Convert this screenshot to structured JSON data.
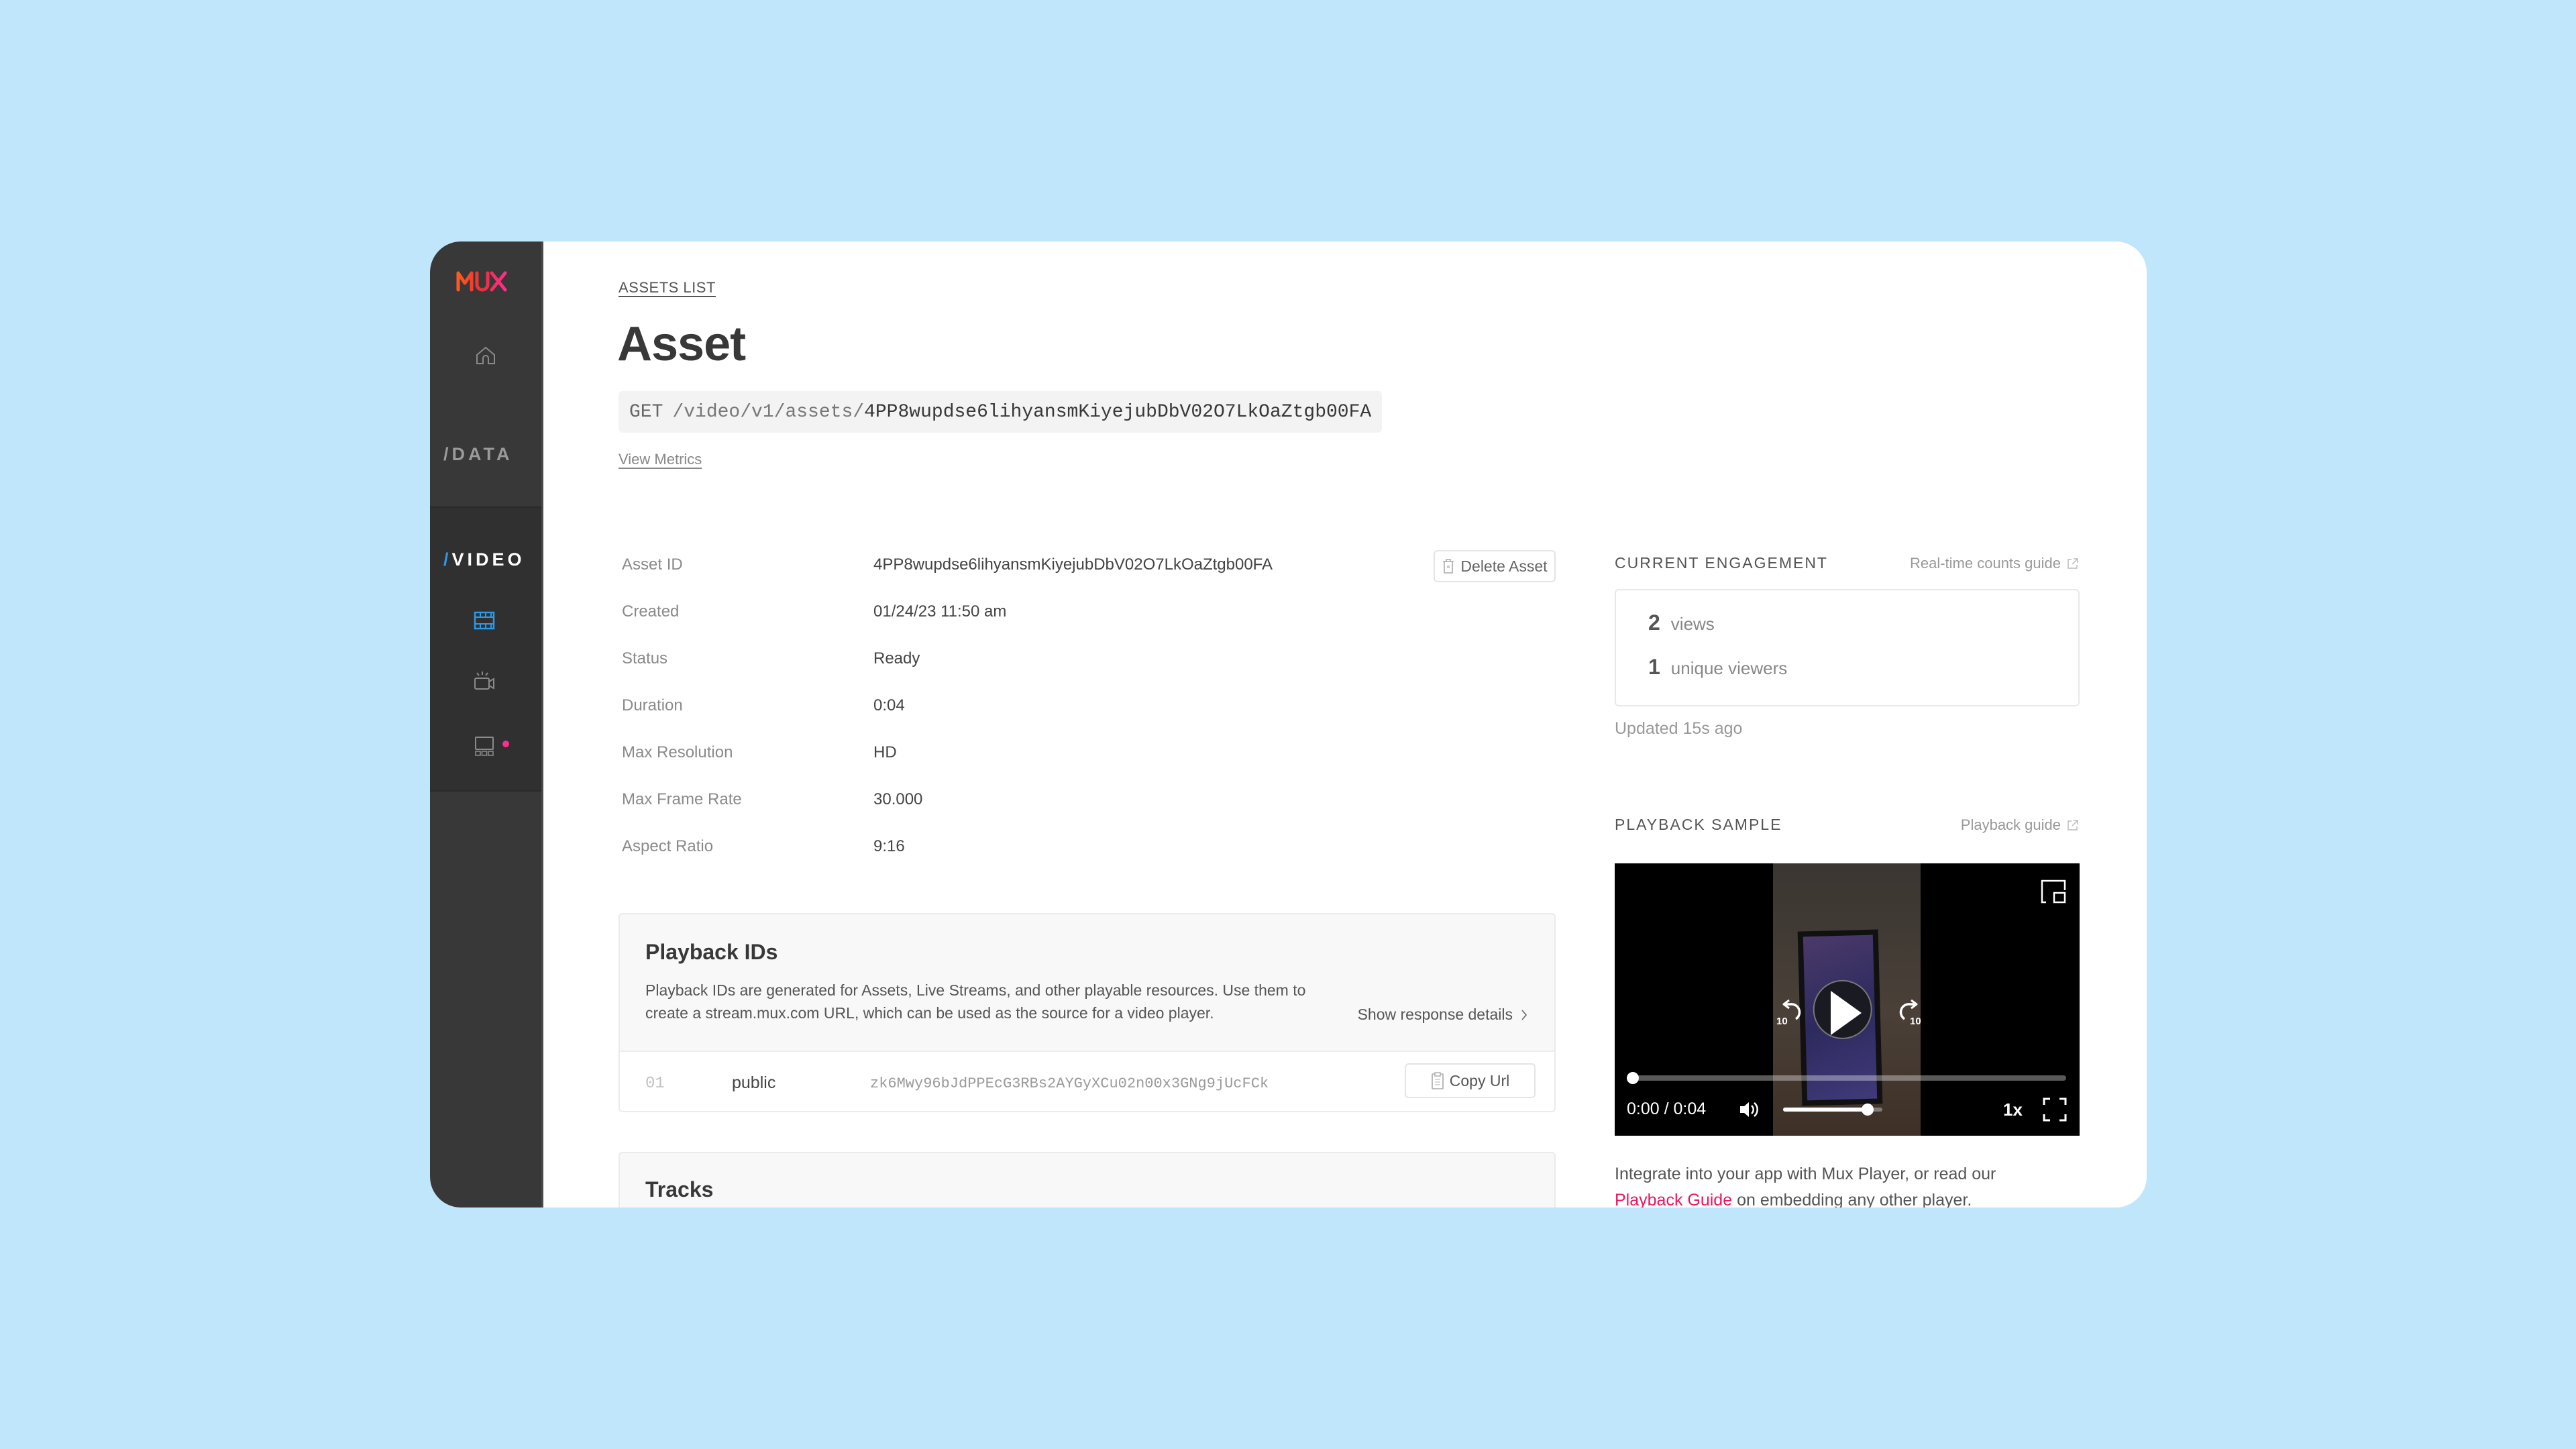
{
  "sidebar": {
    "logo": "MUX",
    "sections": [
      {
        "label": "/DATA"
      },
      {
        "label_slash": "/",
        "label": "VIDEO",
        "items": [
          {
            "name": "assets",
            "icon": "film-icon",
            "active": true
          },
          {
            "name": "live-streams",
            "icon": "live-camera-icon",
            "active": false
          },
          {
            "name": "players",
            "icon": "player-icon",
            "active": false,
            "badge": "new-dot"
          }
        ]
      }
    ],
    "accent": "#2b9ae9",
    "badge_color": "#ff2e8c"
  },
  "header": {
    "breadcrumb": "ASSETS LIST",
    "title": "Asset",
    "endpoint": {
      "method": "GET",
      "path": "/video/v1/assets/",
      "id": "4PP8wupdse6lihyansmKiyejubDbV02O7LkOaZtgb00FA"
    },
    "view_metrics": "View Metrics"
  },
  "details": {
    "rows": [
      {
        "label": "Asset ID",
        "value": "4PP8wupdse6lihyansmKiyejubDbV02O7LkOaZtgb00FA"
      },
      {
        "label": "Created",
        "value": "01/24/23 11:50 am"
      },
      {
        "label": "Status",
        "value": "Ready"
      },
      {
        "label": "Duration",
        "value": "0:04"
      },
      {
        "label": "Max Resolution",
        "value": "HD"
      },
      {
        "label": "Max Frame Rate",
        "value": "30.000"
      },
      {
        "label": "Aspect Ratio",
        "value": "9:16"
      }
    ],
    "delete_button": "Delete Asset"
  },
  "playback_ids": {
    "title": "Playback IDs",
    "description": "Playback IDs are generated for Assets, Live Streams, and other playable resources. Use them to create a stream.mux.com URL, which can be used as the source for a video player.",
    "show_details": "Show response details",
    "rows": [
      {
        "index": "01",
        "policy": "public",
        "id": "zk6Mwy96bJdPPEcG3RBs2AYGyXCu02n00x3GNg9jUcFCk",
        "copy_label": "Copy Url"
      }
    ]
  },
  "tracks": {
    "title": "Tracks"
  },
  "engagement": {
    "title": "CURRENT ENGAGEMENT",
    "guide": "Real-time counts guide",
    "views": {
      "count": "2",
      "label": "views"
    },
    "unique": {
      "count": "1",
      "label": "unique viewers"
    },
    "updated": "Updated 15s ago"
  },
  "playback_sample": {
    "title": "PLAYBACK SAMPLE",
    "guide": "Playback guide",
    "player": {
      "time": "0:00 / 0:04",
      "progress": 0.0,
      "volume": 0.85,
      "rate": "1x",
      "seek_back": "10",
      "seek_forward": "10"
    },
    "integrate_text": "Integrate into your app with Mux Player, or read our",
    "integrate_link": "Playback Guide",
    "integrate_tail": "on embedding any other player.",
    "link_color": "#e8185f"
  }
}
